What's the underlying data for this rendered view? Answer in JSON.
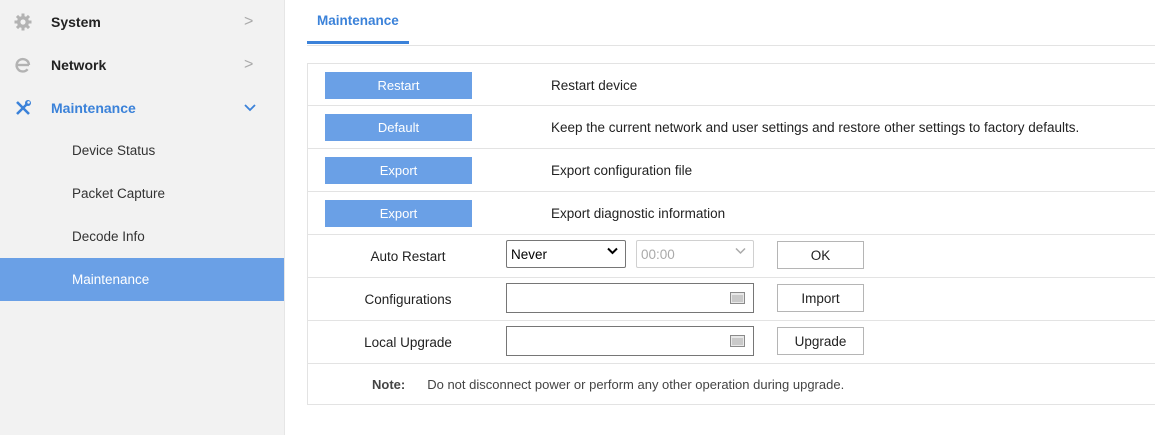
{
  "sidebar": {
    "groups": [
      {
        "label": "System",
        "icon": "gear-icon"
      },
      {
        "label": "Network",
        "icon": "network-icon"
      },
      {
        "label": "Maintenance",
        "icon": "tools-icon"
      }
    ],
    "subitems": [
      "Device Status",
      "Packet Capture",
      "Decode Info",
      "Maintenance"
    ],
    "selected": "Maintenance"
  },
  "tabs": [
    {
      "label": "Maintenance"
    }
  ],
  "actions": [
    {
      "button": "Restart",
      "description": "Restart device"
    },
    {
      "button": "Default",
      "description": "Keep the current network and user settings and restore other settings to factory defaults."
    },
    {
      "button": "Export",
      "description": "Export configuration file"
    },
    {
      "button": "Export",
      "description": "Export diagnostic information"
    }
  ],
  "auto_restart": {
    "label": "Auto Restart",
    "frequency": "Never",
    "time": "00:00",
    "ok_label": "OK"
  },
  "configurations": {
    "label": "Configurations",
    "value": "",
    "button": "Import"
  },
  "local_upgrade": {
    "label": "Local Upgrade",
    "value": "",
    "button": "Upgrade"
  },
  "note": {
    "label": "Note:",
    "text": "Do not disconnect power or perform any other operation during upgrade."
  },
  "colors": {
    "accent": "#3b82d9",
    "button_fill": "#6aa0e6",
    "sidebar_bg": "#f2f2f2"
  }
}
